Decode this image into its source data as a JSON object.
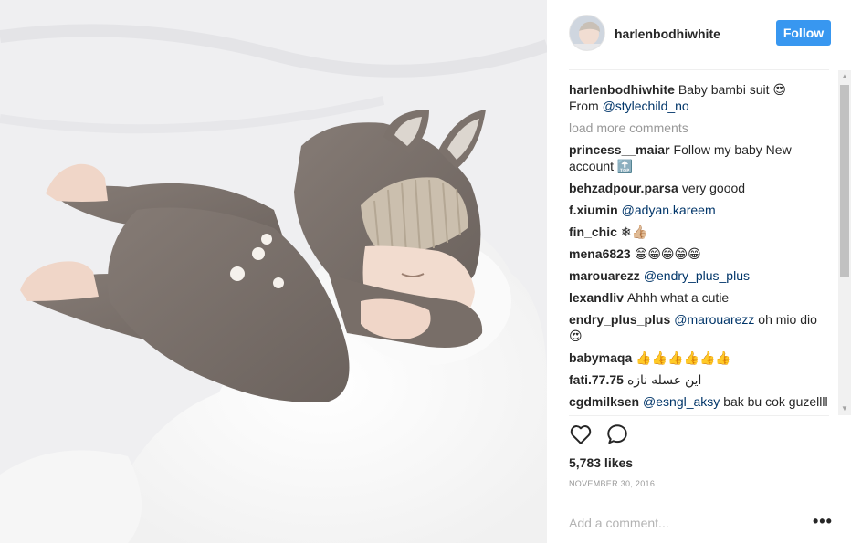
{
  "post": {
    "author": "harlenbodhiwhite",
    "follow_label": "Follow",
    "caption_user": "harlenbodhiwhite",
    "caption_text": "Baby bambi suit 😍",
    "caption_from": "From",
    "caption_mention": "@stylechild_no",
    "load_more": "load more comments",
    "likes": "5,783 likes",
    "date": "NOVEMBER 30, 2016",
    "add_comment_placeholder": "Add a comment...",
    "more_label": "•••"
  },
  "comments": [
    {
      "user": "princess__maiar",
      "text": "Follow my baby New account 🔝"
    },
    {
      "user": "behzadpour.parsa",
      "text": "very goood"
    },
    {
      "user": "f.xiumin",
      "mention": "@adyan.kareem"
    },
    {
      "user": "fin_chic",
      "text": "❄👍🏼"
    },
    {
      "user": "mena6823",
      "text": "😁😁😁😁😁"
    },
    {
      "user": "marouarezz",
      "mention": "@endry_plus_plus"
    },
    {
      "user": "lexandliv",
      "text": "Ahhh what a cutie"
    },
    {
      "user": "endry_plus_plus",
      "mention": "@marouarezz",
      "text": "oh mio dio 😍"
    },
    {
      "user": "babymaqa",
      "text": "👍👍👍👍👍👍"
    },
    {
      "user": "fati.77.75",
      "text": "این عسله نازه"
    },
    {
      "user": "cgdmilksen",
      "mention": "@esngl_aksy",
      "text": "bak bu cok guzellll"
    }
  ],
  "colors": {
    "accent": "#3897f0",
    "mention": "#003569",
    "muted": "#999999",
    "text": "#262626"
  },
  "icons": {
    "like": "heart-outline-icon",
    "comment": "speech-bubble-outline-icon",
    "more": "ellipsis-icon"
  }
}
